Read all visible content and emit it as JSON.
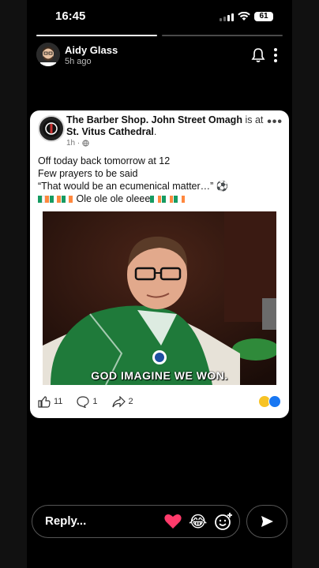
{
  "status_bar": {
    "time": "16:45",
    "battery": "61"
  },
  "story": {
    "progress": [
      true,
      false
    ],
    "user_name": "Aidy Glass",
    "posted_ago": "5h ago"
  },
  "post": {
    "page_name": "The Barber Shop. John Street Omagh",
    "is_at": "is at",
    "location": "St. Vitus Cathedral",
    "location_suffix": ".",
    "time_ago": "1h ·",
    "lines": [
      "Off today back tomorrow at 12",
      "Few prayers to be said",
      "“That would be an ecumenical matter…” ⚽",
      "Ole ole ole oleee"
    ],
    "image_caption": "GOD IMAGINE WE WON.",
    "likes": "11",
    "comments": "1",
    "shares": "2"
  },
  "reply_bar": {
    "placeholder": "Reply...",
    "laugh": "😂"
  },
  "colors": {
    "irish_green": "#169b62",
    "irish_orange": "#ff883e",
    "heart": "#ff3b6b"
  }
}
